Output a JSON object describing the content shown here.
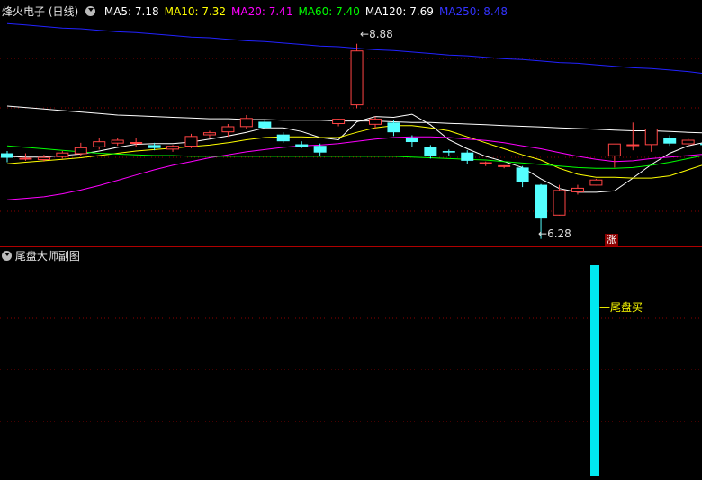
{
  "main_panel": {
    "stock_title": "烽火电子 (日线)",
    "ma_legend": [
      {
        "label": "MA5: 7.18",
        "color": "#ffffff"
      },
      {
        "label": "MA10: 7.32",
        "color": "#ffff00"
      },
      {
        "label": "MA20: 7.41",
        "color": "#ff00ff"
      },
      {
        "label": "MA60: 7.40",
        "color": "#00ff00"
      },
      {
        "label": "MA120: 7.69",
        "color": "#ffffff"
      },
      {
        "label": "MA250: 8.48",
        "color": "#3333ff"
      }
    ],
    "high_label": "8.88",
    "low_label": "6.28",
    "limit_up_badge": "涨"
  },
  "sub_panel": {
    "title": "尾盘大师副图",
    "signal_label": "尾盘买"
  },
  "colors": {
    "up": "#ff4444",
    "down": "#54ffff",
    "grid": "#8b0000",
    "signal_bar": "#00e8f0",
    "signal_text": "#ffff00"
  },
  "chart_data": {
    "type": "candlestick",
    "candles": [
      {
        "o": 7.42,
        "h": 7.45,
        "l": 7.3,
        "c": 7.36
      },
      {
        "o": 7.36,
        "h": 7.42,
        "l": 7.32,
        "c": 7.36
      },
      {
        "o": 7.33,
        "h": 7.4,
        "l": 7.31,
        "c": 7.37
      },
      {
        "o": 7.37,
        "h": 7.45,
        "l": 7.35,
        "c": 7.43
      },
      {
        "o": 7.41,
        "h": 7.56,
        "l": 7.38,
        "c": 7.5
      },
      {
        "o": 7.5,
        "h": 7.62,
        "l": 7.47,
        "c": 7.58
      },
      {
        "o": 7.55,
        "h": 7.63,
        "l": 7.52,
        "c": 7.6
      },
      {
        "o": 7.57,
        "h": 7.63,
        "l": 7.5,
        "c": 7.57
      },
      {
        "o": 7.53,
        "h": 7.56,
        "l": 7.46,
        "c": 7.49
      },
      {
        "o": 7.47,
        "h": 7.53,
        "l": 7.44,
        "c": 7.52
      },
      {
        "o": 7.51,
        "h": 7.68,
        "l": 7.49,
        "c": 7.65
      },
      {
        "o": 7.66,
        "h": 7.72,
        "l": 7.63,
        "c": 7.7
      },
      {
        "o": 7.7,
        "h": 7.81,
        "l": 7.64,
        "c": 7.78
      },
      {
        "o": 7.77,
        "h": 7.93,
        "l": 7.74,
        "c": 7.89
      },
      {
        "o": 7.84,
        "h": 7.86,
        "l": 7.75,
        "c": 7.76
      },
      {
        "o": 7.67,
        "h": 7.7,
        "l": 7.56,
        "c": 7.58
      },
      {
        "o": 7.54,
        "h": 7.58,
        "l": 7.49,
        "c": 7.51
      },
      {
        "o": 7.52,
        "h": 7.55,
        "l": 7.39,
        "c": 7.43
      },
      {
        "o": 7.81,
        "h": 7.88,
        "l": 7.78,
        "c": 7.88
      },
      {
        "o": 8.06,
        "h": 8.88,
        "l": 8.02,
        "c": 8.79
      },
      {
        "o": 7.8,
        "h": 7.91,
        "l": 7.74,
        "c": 7.88
      },
      {
        "o": 7.83,
        "h": 7.87,
        "l": 7.65,
        "c": 7.7
      },
      {
        "o": 7.62,
        "h": 7.66,
        "l": 7.51,
        "c": 7.57
      },
      {
        "o": 7.51,
        "h": 7.53,
        "l": 7.35,
        "c": 7.38
      },
      {
        "o": 7.45,
        "h": 7.47,
        "l": 7.39,
        "c": 7.43
      },
      {
        "o": 7.43,
        "h": 7.46,
        "l": 7.28,
        "c": 7.32
      },
      {
        "o": 7.28,
        "h": 7.31,
        "l": 7.25,
        "c": 7.3
      },
      {
        "o": 7.26,
        "h": 7.26,
        "l": 7.22,
        "c": 7.26
      },
      {
        "o": 7.23,
        "h": 7.25,
        "l": 6.97,
        "c": 7.04
      },
      {
        "o": 7.0,
        "h": 7.01,
        "l": 6.28,
        "c": 6.55
      },
      {
        "o": 6.59,
        "h": 7.0,
        "l": 6.59,
        "c": 6.93
      },
      {
        "o": 6.9,
        "h": 7.0,
        "l": 6.87,
        "c": 6.96
      },
      {
        "o": 6.99,
        "h": 7.08,
        "l": 6.99,
        "c": 7.07
      },
      {
        "o": 7.38,
        "h": 7.46,
        "l": 7.23,
        "c": 7.55
      },
      {
        "o": 7.54,
        "h": 7.83,
        "l": 7.46,
        "c": 7.54
      },
      {
        "o": 7.53,
        "h": 7.75,
        "l": 7.44,
        "c": 7.75
      },
      {
        "o": 7.62,
        "h": 7.66,
        "l": 7.52,
        "c": 7.55
      },
      {
        "o": 7.54,
        "h": 7.63,
        "l": 7.5,
        "c": 7.6
      },
      {
        "o": 7.55,
        "h": 7.58,
        "l": 7.5,
        "c": 7.53
      }
    ],
    "ma_lines": [
      {
        "name": "MA5",
        "color": "#ffffff",
        "values": [
          7.38,
          7.37,
          7.37,
          7.39,
          7.41,
          7.45,
          7.5,
          7.54,
          7.55,
          7.55,
          7.57,
          7.61,
          7.65,
          7.7,
          7.76,
          7.76,
          7.71,
          7.63,
          7.6,
          7.84,
          7.91,
          7.9,
          7.94,
          7.8,
          7.6,
          7.48,
          7.38,
          7.31,
          7.23,
          7.08,
          6.95,
          6.9,
          6.9,
          6.92,
          7.09,
          7.27,
          7.42,
          7.52,
          7.57
        ]
      },
      {
        "name": "MA10",
        "color": "#ffff00",
        "values": [
          7.28,
          7.3,
          7.32,
          7.34,
          7.36,
          7.39,
          7.42,
          7.45,
          7.47,
          7.49,
          7.51,
          7.53,
          7.56,
          7.6,
          7.63,
          7.64,
          7.64,
          7.63,
          7.63,
          7.7,
          7.76,
          7.79,
          7.79,
          7.76,
          7.72,
          7.64,
          7.56,
          7.48,
          7.4,
          7.33,
          7.22,
          7.14,
          7.1,
          7.1,
          7.09,
          7.09,
          7.12,
          7.2,
          7.28
        ]
      },
      {
        "name": "MA20",
        "color": "#ff00ff",
        "values": [
          6.8,
          6.82,
          6.84,
          6.88,
          6.93,
          6.99,
          7.06,
          7.13,
          7.2,
          7.26,
          7.31,
          7.36,
          7.4,
          7.44,
          7.47,
          7.5,
          7.52,
          7.53,
          7.55,
          7.58,
          7.61,
          7.63,
          7.64,
          7.64,
          7.63,
          7.61,
          7.59,
          7.56,
          7.52,
          7.48,
          7.43,
          7.38,
          7.34,
          7.31,
          7.32,
          7.35,
          7.37,
          7.39,
          7.41
        ]
      },
      {
        "name": "MA60",
        "color": "#00ff00",
        "values": [
          7.52,
          7.5,
          7.48,
          7.46,
          7.44,
          7.42,
          7.41,
          7.4,
          7.39,
          7.39,
          7.38,
          7.38,
          7.38,
          7.38,
          7.38,
          7.38,
          7.38,
          7.38,
          7.38,
          7.38,
          7.38,
          7.38,
          7.37,
          7.36,
          7.35,
          7.34,
          7.33,
          7.31,
          7.29,
          7.27,
          7.25,
          7.23,
          7.22,
          7.22,
          7.23,
          7.26,
          7.3,
          7.35,
          7.4
        ]
      },
      {
        "name": "MA120",
        "color": "#ffffff",
        "values": [
          8.05,
          8.03,
          8.01,
          7.99,
          7.97,
          7.95,
          7.93,
          7.92,
          7.91,
          7.9,
          7.89,
          7.88,
          7.88,
          7.87,
          7.87,
          7.86,
          7.86,
          7.86,
          7.85,
          7.85,
          7.85,
          7.84,
          7.83,
          7.83,
          7.82,
          7.81,
          7.8,
          7.79,
          7.78,
          7.77,
          7.76,
          7.75,
          7.74,
          7.73,
          7.72,
          7.72,
          7.71,
          7.7,
          7.69
        ]
      },
      {
        "name": "MA250",
        "color": "#2222ff",
        "values": [
          9.15,
          9.13,
          9.11,
          9.09,
          9.08,
          9.06,
          9.04,
          9.03,
          9.01,
          8.99,
          8.97,
          8.96,
          8.94,
          8.92,
          8.91,
          8.89,
          8.87,
          8.85,
          8.84,
          8.82,
          8.8,
          8.79,
          8.77,
          8.75,
          8.73,
          8.72,
          8.7,
          8.68,
          8.67,
          8.65,
          8.63,
          8.62,
          8.6,
          8.58,
          8.56,
          8.55,
          8.53,
          8.51,
          8.48
        ]
      }
    ],
    "signal": {
      "candle_index": 32,
      "value": 1
    }
  }
}
